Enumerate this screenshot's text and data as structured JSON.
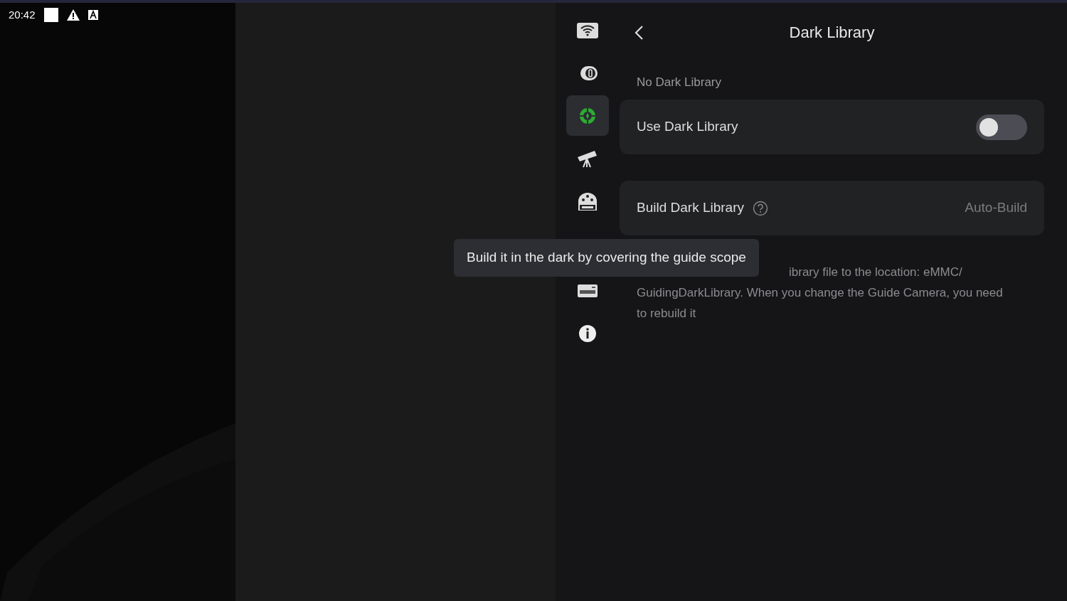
{
  "status_bar": {
    "time": "20:42"
  },
  "sidebar": {
    "items": [
      {
        "kind": "wifi",
        "selected": false
      },
      {
        "kind": "filter",
        "selected": false
      },
      {
        "kind": "guide",
        "selected": true
      },
      {
        "kind": "telescope",
        "selected": false
      },
      {
        "kind": "efw",
        "selected": false
      },
      {
        "kind": "emmc",
        "selected": false
      },
      {
        "kind": "info",
        "selected": false
      }
    ]
  },
  "header": {
    "title": "Dark Library"
  },
  "status": "No Dark Library",
  "settings": [
    {
      "kind": "toggle",
      "label": "Use Dark Library",
      "checked": false
    },
    {
      "kind": "value",
      "label": "Build Dark Library",
      "value": "Auto-Build",
      "help": true
    }
  ],
  "tooltip": "Build it in the dark by covering the guide scope",
  "description_lines": [
    "ibrary file to the location: eMMC/",
    "GuidingDarkLibrary. When you change the Guide Camera, you need",
    "to rebuild it"
  ]
}
